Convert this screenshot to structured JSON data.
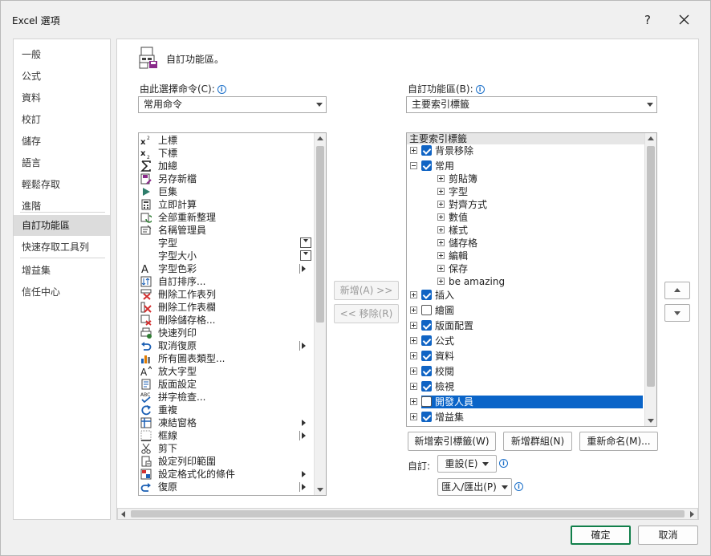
{
  "window": {
    "title": "Excel 選項",
    "help": "?"
  },
  "nav": {
    "items": [
      "一般",
      "公式",
      "資料",
      "校訂",
      "儲存",
      "語言",
      "輕鬆存取",
      "進階",
      "自訂功能區",
      "快速存取工具列",
      "增益集",
      "信任中心"
    ],
    "selected": 8
  },
  "header": {
    "title": "自訂功能區。"
  },
  "left_panel": {
    "label": "由此選擇命令(C):",
    "combo_value": "常用命令",
    "commands": [
      {
        "label": "上標",
        "icon": "superscript-icon",
        "tail": ""
      },
      {
        "label": "下標",
        "icon": "subscript-icon",
        "tail": ""
      },
      {
        "label": "加總",
        "icon": "sum-icon",
        "tail": ""
      },
      {
        "label": "另存新檔",
        "icon": "save-as-icon",
        "tail": ""
      },
      {
        "label": "巨集",
        "icon": "macro-icon",
        "tail": ""
      },
      {
        "label": "立即計算",
        "icon": "calculator-icon",
        "tail": ""
      },
      {
        "label": "全部重新整理",
        "icon": "refresh-all-icon",
        "tail": ""
      },
      {
        "label": "名稱管理員",
        "icon": "name-manager-icon",
        "tail": ""
      },
      {
        "label": "字型",
        "icon": "",
        "tail": "combo"
      },
      {
        "label": "字型大小",
        "icon": "",
        "tail": "combo"
      },
      {
        "label": "字型色彩",
        "icon": "font-color-icon",
        "tail": "split"
      },
      {
        "label": "自訂排序...",
        "icon": "custom-sort-icon",
        "tail": ""
      },
      {
        "label": "刪除工作表列",
        "icon": "delete-row-icon",
        "tail": ""
      },
      {
        "label": "刪除工作表欄",
        "icon": "delete-column-icon",
        "tail": ""
      },
      {
        "label": "刪除儲存格...",
        "icon": "delete-cells-icon",
        "tail": ""
      },
      {
        "label": "快速列印",
        "icon": "quick-print-icon",
        "tail": ""
      },
      {
        "label": "取消復原",
        "icon": "undo-icon",
        "tail": "split"
      },
      {
        "label": "所有圖表類型...",
        "icon": "chart-types-icon",
        "tail": ""
      },
      {
        "label": "放大字型",
        "icon": "grow-font-icon",
        "tail": ""
      },
      {
        "label": "版面設定",
        "icon": "page-setup-icon",
        "tail": ""
      },
      {
        "label": "拼字檢查...",
        "icon": "spelling-icon",
        "tail": ""
      },
      {
        "label": "重複",
        "icon": "repeat-icon",
        "tail": ""
      },
      {
        "label": "凍結窗格",
        "icon": "freeze-panes-icon",
        "tail": "sub"
      },
      {
        "label": "框線",
        "icon": "borders-icon",
        "tail": "split"
      },
      {
        "label": "剪下",
        "icon": "cut-icon",
        "tail": ""
      },
      {
        "label": "設定列印範圍",
        "icon": "print-area-icon",
        "tail": ""
      },
      {
        "label": "設定格式化的條件",
        "icon": "conditional-format-icon",
        "tail": "sub"
      },
      {
        "label": "復原",
        "icon": "redo-icon",
        "tail": "split"
      }
    ]
  },
  "middle": {
    "add_label": "新增(A) >>",
    "remove_label": "<< 移除(R)"
  },
  "right_panel": {
    "label": "自訂功能區(B):",
    "combo_value": "主要索引標籤",
    "tree_header": "主要索引標籤",
    "tabs_top": [
      {
        "label": "背景移除",
        "checked": true,
        "expanded": false
      },
      {
        "label": "常用",
        "checked": true,
        "expanded": true
      }
    ],
    "groups": [
      "剪貼簿",
      "字型",
      "對齊方式",
      "數值",
      "樣式",
      "儲存格",
      "編輯",
      "保存",
      "be amazing"
    ],
    "tabs_bottom": [
      {
        "label": "插入",
        "checked": true
      },
      {
        "label": "繪圖",
        "checked": false
      },
      {
        "label": "版面配置",
        "checked": true
      },
      {
        "label": "公式",
        "checked": true
      },
      {
        "label": "資料",
        "checked": true
      },
      {
        "label": "校閱",
        "checked": true
      },
      {
        "label": "檢視",
        "checked": true
      },
      {
        "label": "開發人員",
        "checked": false,
        "highlighted": true
      },
      {
        "label": "增益集",
        "checked": true
      }
    ],
    "new_tab_label": "新增索引標籤(W)",
    "new_group_label": "新增群組(N)",
    "rename_label": "重新命名(M)...",
    "customize_label": "自訂:",
    "reset_label": "重設(E)",
    "import_export_label": "匯入/匯出(P)"
  },
  "footer": {
    "ok_label": "確定",
    "cancel_label": "取消"
  },
  "colors": {
    "accent": "#0a64c8",
    "check": "#1064c4",
    "default_button_border": "#117f4a"
  }
}
